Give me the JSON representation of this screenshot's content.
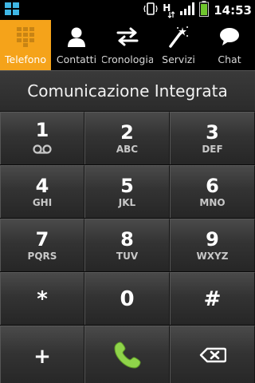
{
  "status_bar": {
    "time": "14:53",
    "icons": [
      "app-grid-icon",
      "vibrate-icon",
      "hsdpa-data-icon",
      "signal-icon",
      "battery-icon"
    ],
    "data_indicator": "H"
  },
  "tabs": [
    {
      "label": "Telefono",
      "icon": "dialpad-icon",
      "active": true
    },
    {
      "label": "Contatti",
      "icon": "contact-icon",
      "active": false
    },
    {
      "label": "Cronologia",
      "icon": "swap-arrows-icon",
      "active": false
    },
    {
      "label": "Servizi",
      "icon": "magic-wand-icon",
      "active": false
    },
    {
      "label": "Chat",
      "icon": "chat-bubble-icon",
      "active": false
    }
  ],
  "title": "Comunicazione Integrata",
  "keys": [
    {
      "digit": "1",
      "letters": ""
    },
    {
      "digit": "2",
      "letters": "ABC"
    },
    {
      "digit": "3",
      "letters": "DEF"
    },
    {
      "digit": "4",
      "letters": "GHI"
    },
    {
      "digit": "5",
      "letters": "JKL"
    },
    {
      "digit": "6",
      "letters": "MNO"
    },
    {
      "digit": "7",
      "letters": "PQRS"
    },
    {
      "digit": "8",
      "letters": "TUV"
    },
    {
      "digit": "9",
      "letters": "WXYZ"
    },
    {
      "digit": "*",
      "letters": ""
    },
    {
      "digit": "0",
      "letters": ""
    },
    {
      "digit": "#",
      "letters": ""
    },
    {
      "digit": "+",
      "letters": ""
    }
  ],
  "colors": {
    "active_tab": "#f5a31a",
    "call_green": "#8fd44a"
  }
}
